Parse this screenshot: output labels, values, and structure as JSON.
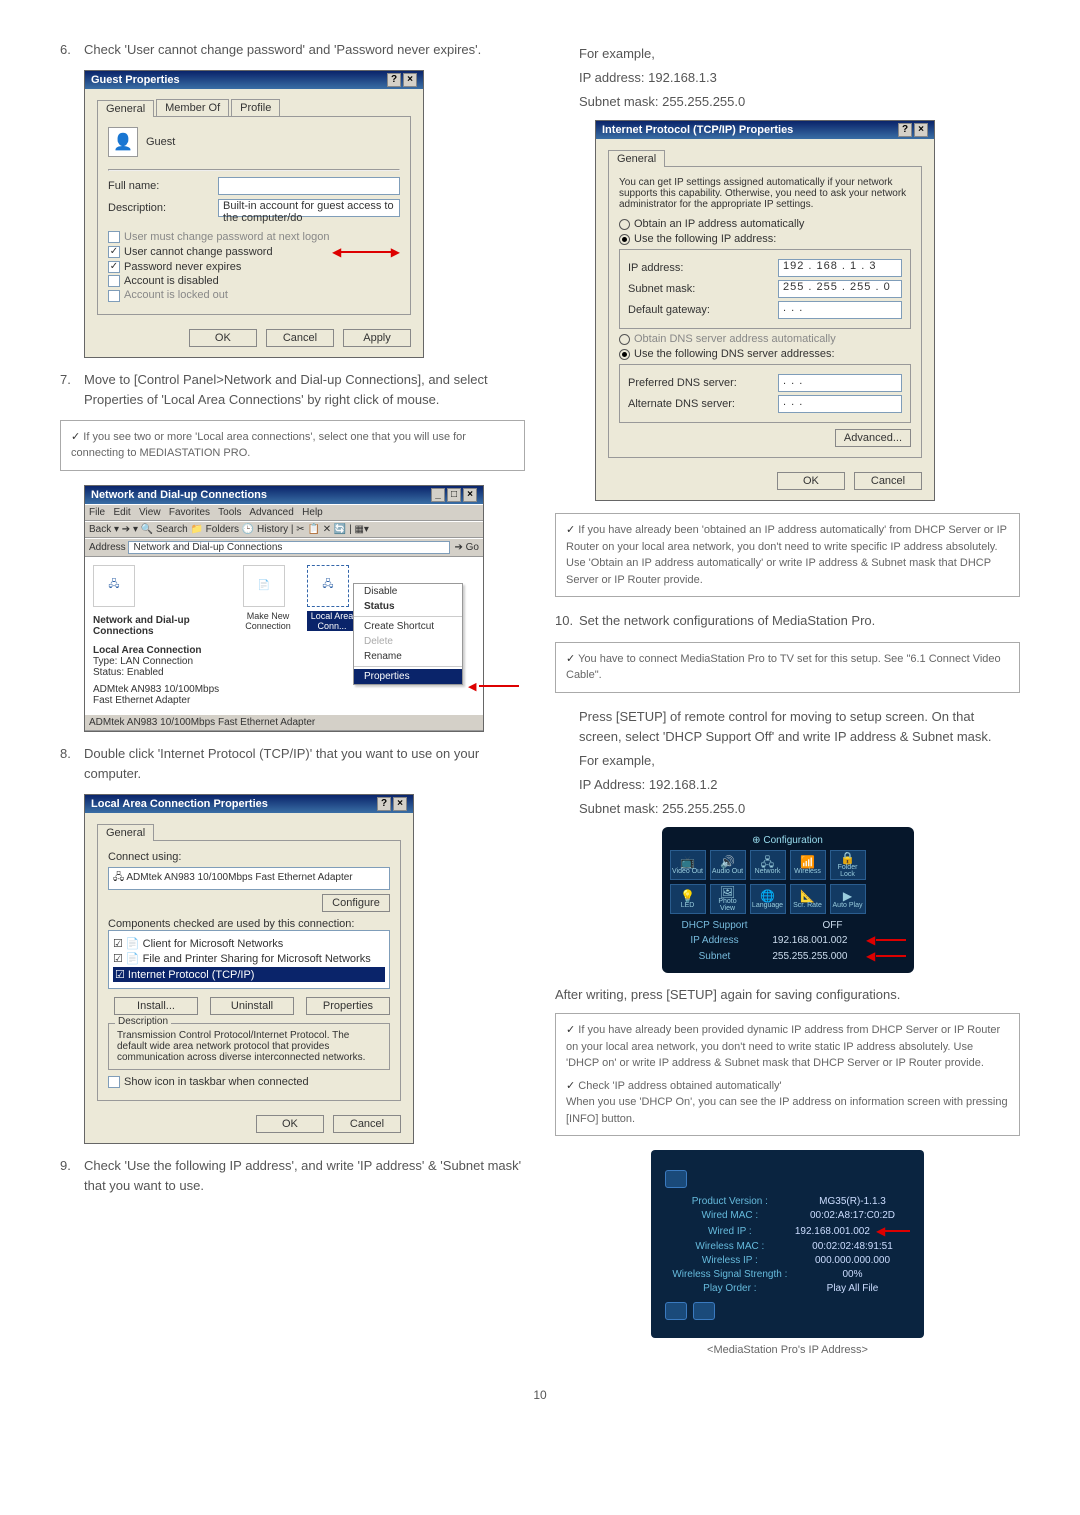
{
  "left": {
    "step6": {
      "num": "6.",
      "txt": "Check 'User cannot change password' and 'Password never expires'."
    },
    "guest_dlg": {
      "title": "Guest Properties",
      "help": "?",
      "close": "×",
      "tabs": [
        "General",
        "Member Of",
        "Profile"
      ],
      "account_label": "Guest",
      "full_name_lbl": "Full name:",
      "full_name_val": "",
      "description_lbl": "Description:",
      "description_val": "Built-in account for guest access to the computer/do",
      "opt1": "User must change password at next logon",
      "opt2": "User cannot change password",
      "opt3": "Password never expires",
      "opt4": "Account is disabled",
      "opt5": "Account is locked out",
      "ok": "OK",
      "cancel": "Cancel",
      "apply": "Apply"
    },
    "step7": {
      "num": "7.",
      "txt": "Move to [Control Panel>Network and Dial-up Connections], and select Properties of 'Local Area Connections' by right click of mouse."
    },
    "tip1": "If you see two or more 'Local area connections', select one that you will use for connecting to MEDIASTATION PRO.",
    "net_dlg": {
      "title": "Network and Dial-up Connections",
      "menus": [
        "File",
        "Edit",
        "View",
        "Favorites",
        "Tools",
        "Advanced",
        "Help"
      ],
      "toolbar": "Back ▾ ➔ ▾ 🔍 Search  📁 Folders  🕒 History | ✂ 📋 ✕ 🔄 | ▦▾",
      "addr_lbl": "Address",
      "addr_val": "Network and Dial-up Connections",
      "go": "Go",
      "left_title": "Network and Dial-up Connections",
      "left_sub1": "Local Area Connection",
      "left_sub2": "Type: LAN Connection",
      "left_sub3": "Status: Enabled",
      "left_sub4": "ADMtek AN983 10/100Mbps Fast Ethernet Adapter",
      "icon1": "Make New Connection",
      "icon2": "Local Area Conn...",
      "ctx": [
        "Disable",
        "Status",
        "",
        "Create Shortcut",
        "Delete",
        "Rename",
        "",
        "Properties"
      ],
      "status": "ADMtek AN983 10/100Mbps Fast Ethernet Adapter"
    },
    "step8": {
      "num": "8.",
      "txt": "Double click 'Internet Protocol (TCP/IP)' that you want to use on your computer."
    },
    "lac_dlg": {
      "title": "Local Area Connection Properties",
      "tab": "General",
      "connect_using": "Connect using:",
      "nic": "ADMtek AN983 10/100Mbps Fast Ethernet Adapter",
      "configure": "Configure",
      "components_lbl": "Components checked are used by this connection:",
      "comp1": "Client for Microsoft Networks",
      "comp2": "File and Printer Sharing for Microsoft Networks",
      "comp3": "Internet Protocol (TCP/IP)",
      "install": "Install...",
      "uninstall": "Uninstall",
      "properties": "Properties",
      "desc_lbl": "Description",
      "desc_txt": "Transmission Control Protocol/Internet Protocol. The default wide area network protocol that provides communication across diverse interconnected networks.",
      "show_icon": "Show icon in taskbar when connected",
      "ok": "OK",
      "cancel": "Cancel"
    },
    "step9": {
      "num": "9.",
      "txt": "Check 'Use the following IP address', and write 'IP address' & 'Subnet mask' that you want to use."
    }
  },
  "right": {
    "ex_label": "For example,",
    "ex_ip": "IP address: 192.168.1.3",
    "ex_mask": "Subnet mask: 255.255.255.0",
    "tcp_dlg": {
      "title": "Internet Protocol (TCP/IP) Properties",
      "tab": "General",
      "intro": "You can get IP settings assigned automatically if your network supports this capability. Otherwise, you need to ask your network administrator for the appropriate IP settings.",
      "r1": "Obtain an IP address automatically",
      "r2": "Use the following IP address:",
      "ip_lbl": "IP address:",
      "ip_val": "192 . 168 .   1  .   3",
      "mask_lbl": "Subnet mask:",
      "mask_val": "255 . 255 . 255 .   0",
      "gw_lbl": "Default gateway:",
      "gw_val": ".       .       .",
      "r3": "Obtain DNS server address automatically",
      "r4": "Use the following DNS server addresses:",
      "dns1_lbl": "Preferred DNS server:",
      "dns1_val": ".       .       .",
      "dns2_lbl": "Alternate DNS server:",
      "dns2_val": ".       .       .",
      "advanced": "Advanced...",
      "ok": "OK",
      "cancel": "Cancel"
    },
    "tip2": "If you have already been 'obtained an IP address automatically' from DHCP Server or IP Router on your local area network, you don't need to write specific IP address absolutely. Use 'Obtain an IP address automatically' or write IP address & Subnet mask that DHCP Server or IP Router provide.",
    "step10": {
      "num": "10.",
      "txt": "Set the network configurations of MediaStation Pro."
    },
    "tip3": "You have to connect MediaStation Pro to TV set for this setup. See \"6.1 Connect Video Cable\".",
    "para1": "Press [SETUP] of remote control for moving to setup screen. On that screen, select 'DHCP Support Off' and write IP address & Subnet mask.",
    "ex2_label": "For example,",
    "ex2_ip": "IP Address: 192.168.1.2",
    "ex2_mask": "Subnet mask: 255.255.255.0",
    "ms_cfg": {
      "title": "Configuration",
      "cells": [
        "Video Out",
        "Audio Out",
        "Network",
        "Wireless",
        "Folder Lock",
        "",
        "LED",
        "Photo View",
        "Language",
        "Scr. Rate",
        "Auto Play",
        ""
      ],
      "rows": [
        {
          "k": "DHCP Support",
          "v": "OFF"
        },
        {
          "k": "IP Address",
          "v": "192.168.001.002"
        },
        {
          "k": "Subnet",
          "v": "255.255.255.000"
        }
      ]
    },
    "after_label": "After writing, press [SETUP] again for saving configurations.",
    "tip4a": "If you have already been provided dynamic IP address from DHCP Server or IP Router on your local area network, you don't need to write static IP address absolutely. Use 'DHCP on' or write IP address & Subnet mask that DHCP Server or IP Router provide.",
    "tip4b_head": "Check 'IP address obtained automatically'",
    "tip4b": "When you use 'DHCP On', you can see the IP address on information screen with pressing [INFO] button.",
    "ms_info": {
      "rows": [
        {
          "k": "Product Version :",
          "v": "MG35(R)-1.1.3"
        },
        {
          "k": "Wired MAC :",
          "v": "00:02:A8:17:C0:2D"
        },
        {
          "k": "Wired IP :",
          "v": "192.168.001.002"
        },
        {
          "k": "Wireless MAC :",
          "v": "00:02:02:48:91:51"
        },
        {
          "k": "Wireless IP :",
          "v": "000.000.000.000"
        },
        {
          "k": "Wireless Signal Strength :",
          "v": "00%"
        },
        {
          "k": "Play Order :",
          "v": "Play All File"
        }
      ]
    },
    "info_caption": "<MediaStation Pro's IP Address>"
  },
  "page_number": "10"
}
